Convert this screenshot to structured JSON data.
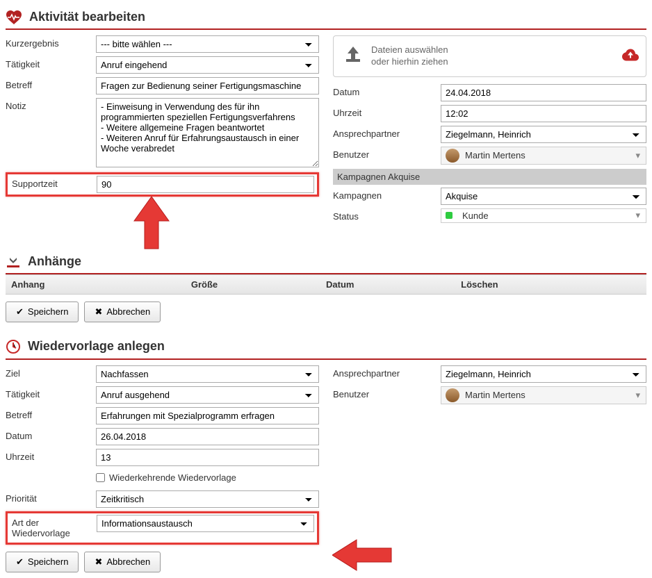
{
  "activity": {
    "title": "Aktivität bearbeiten",
    "kurzergebnis_label": "Kurzergebnis",
    "kurzergebnis_value": "--- bitte wählen ---",
    "taetigkeit_label": "Tätigkeit",
    "taetigkeit_value": "Anruf eingehend",
    "betreff_label": "Betreff",
    "betreff_value": "Fragen zur Bedienung seiner Fertigungsmaschine",
    "notiz_label": "Notiz",
    "notiz_value": "- Einweisung in Verwendung des für ihn programmierten speziellen Fertigungsverfahrens\n- Weitere allgemeine Fragen beantwortet\n- Weiteren Anruf für Erfahrungsaustausch in einer Woche verabredet",
    "supportzeit_label": "Supportzeit",
    "supportzeit_value": "90",
    "dropzone_line1": "Dateien auswählen",
    "dropzone_line2": "oder hierhin ziehen",
    "datum_label": "Datum",
    "datum_value": "24.04.2018",
    "uhrzeit_label": "Uhrzeit",
    "uhrzeit_value": "12:02",
    "ansprechpartner_label": "Ansprechpartner",
    "ansprechpartner_value": "Ziegelmann, Heinrich",
    "benutzer_label": "Benutzer",
    "benutzer_value": "Martin Mertens",
    "kampagnen_section": "Kampagnen Akquise",
    "kampagnen_label": "Kampagnen",
    "kampagnen_value": "Akquise",
    "status_label": "Status",
    "status_value": "Kunde"
  },
  "attachments": {
    "title": "Anhänge",
    "col_anhang": "Anhang",
    "col_groesse": "Größe",
    "col_datum": "Datum",
    "col_loeschen": "Löschen"
  },
  "buttons": {
    "speichern": "Speichern",
    "abbrechen": "Abbrechen"
  },
  "followup": {
    "title": "Wiedervorlage anlegen",
    "ziel_label": "Ziel",
    "ziel_value": "Nachfassen",
    "taetigkeit_label": "Tätigkeit",
    "taetigkeit_value": "Anruf ausgehend",
    "betreff_label": "Betreff",
    "betreff_value": "Erfahrungen mit Spezialprogramm erfragen",
    "datum_label": "Datum",
    "datum_value": "26.04.2018",
    "uhrzeit_label": "Uhrzeit",
    "uhrzeit_value": "13",
    "recurring_label": "Wiederkehrende Wiedervorlage",
    "prioritaet_label": "Priorität",
    "prioritaet_value": "Zeitkritisch",
    "art_label": "Art der Wiedervorlage",
    "art_value": "Informationsaustausch",
    "ansprechpartner_label": "Ansprechpartner",
    "ansprechpartner_value": "Ziegelmann, Heinrich",
    "benutzer_label": "Benutzer",
    "benutzer_value": "Martin Mertens"
  }
}
